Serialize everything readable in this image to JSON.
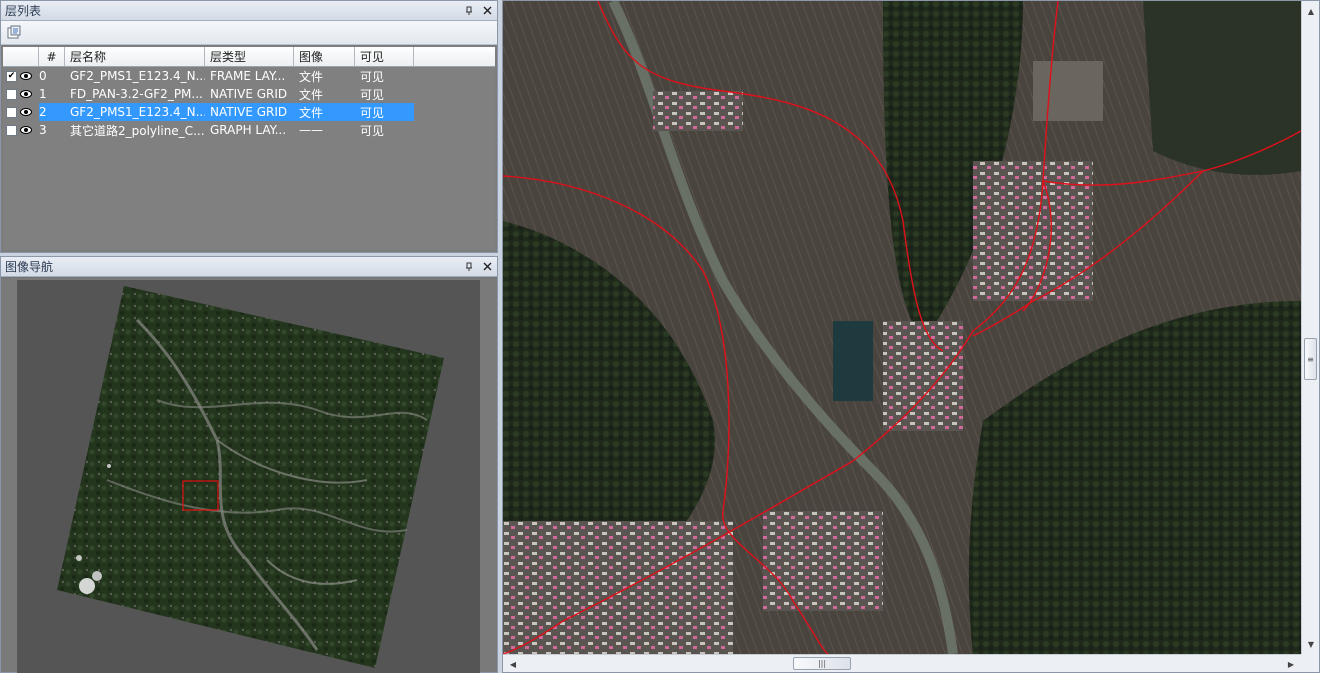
{
  "layer_panel": {
    "title": "层列表",
    "pin_icon": "pin-icon",
    "close_icon": "close-icon",
    "columns": [
      "#",
      "层名称",
      "层类型",
      "图像",
      "可见"
    ],
    "rows": [
      {
        "num": "0",
        "checked": true,
        "name": "GF2_PMS1_E123.4_N...",
        "type": "FRAME LAY...",
        "image": "文件",
        "visible": "可见",
        "selected": false
      },
      {
        "num": "1",
        "checked": false,
        "name": "FD_PAN-3.2-GF2_PM...",
        "type": "NATIVE GRID",
        "image": "文件",
        "visible": "可见",
        "selected": false
      },
      {
        "num": "2",
        "checked": false,
        "name": "GF2_PMS1_E123.4_N...",
        "type": "NATIVE GRID",
        "image": "文件",
        "visible": "可见",
        "selected": true
      },
      {
        "num": "3",
        "checked": false,
        "name": "其它道路2_polyline_C...",
        "type": "GRAPH LAY...",
        "image": "——",
        "visible": "可见",
        "selected": false
      }
    ]
  },
  "nav_panel": {
    "title": "图像导航"
  },
  "colors": {
    "selection": "#3399ff",
    "road_line": "#e0101a",
    "viewport_box": "#e01010"
  }
}
